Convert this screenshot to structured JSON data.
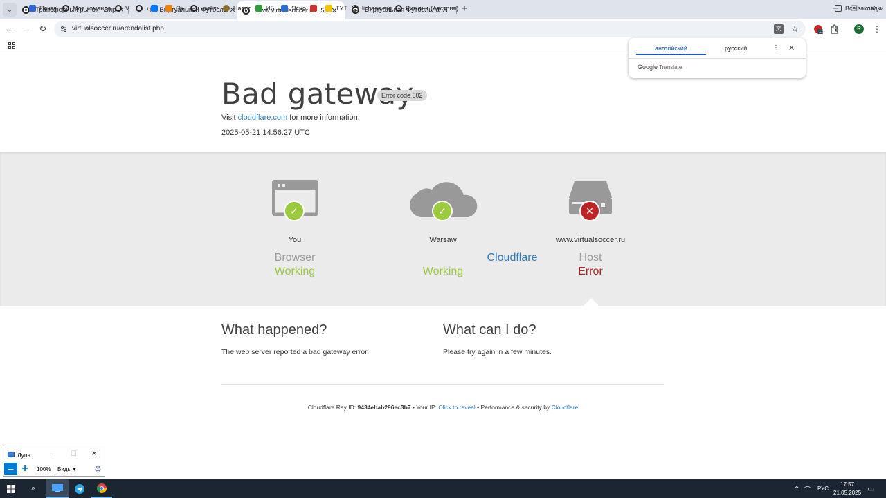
{
  "browser": {
    "tabs": [
      {
        "title": "Трансферный рынок - Виртуа",
        "close": "✕"
      },
      {
        "title": "Чат Виртуальной Футбольной",
        "close": "✕"
      },
      {
        "title": "www.virtualsoccer.ru | 502: Bad",
        "close": "✕"
      },
      {
        "title": "Виртуальная Футбольная Лига",
        "close": "✕"
      }
    ],
    "new_tab": "+",
    "address": "virtualsoccer.ru/arendalist.php",
    "profile_initial": "R",
    "ext_badge": "12",
    "bookmarks": [
      {
        "label": "Почта",
        "icon": "mail-icon",
        "color": "#3366cc"
      },
      {
        "label": "Моя команда",
        "icon": "soccer-ball-icon",
        "color": "#222222"
      },
      {
        "label": "V",
        "icon": "soccer-ball-icon",
        "color": "#222222"
      },
      {
        "label": "",
        "icon": "soccer-ball-icon",
        "color": "#222222"
      },
      {
        "label": "",
        "icon": "vk-icon",
        "color": "#0077ff"
      },
      {
        "label": "Ок",
        "icon": "ok-icon",
        "color": "#ee8208"
      },
      {
        "label": "vsolist",
        "icon": "soccer-ball-icon",
        "color": "#222222"
      },
      {
        "label": "Налог",
        "icon": "nalog-icon",
        "color": "#8b6d2a"
      },
      {
        "label": "ИБ",
        "icon": "ib-icon",
        "color": "#2e9d3a"
      },
      {
        "label": "Ясно",
        "icon": "yasno-icon",
        "color": "#2a6ecf"
      },
      {
        "label": "",
        "icon": "m-icon",
        "color": "#d32f2f"
      },
      {
        "label": "ТУТ",
        "icon": "tut-icon",
        "color": "#f5c400"
      },
      {
        "label": "lichess.org",
        "icon": "lichess-icon",
        "color": "#333333"
      },
      {
        "label": "Ритцинг (Австрия)",
        "icon": "soccer-ball-icon",
        "color": "#222222"
      }
    ],
    "all_bookmarks": "Все закладки"
  },
  "translate_popup": {
    "lang_from": "английский",
    "lang_to": "русский",
    "brand_google": "Google",
    "brand_translate": "Translate"
  },
  "page": {
    "title": "Bad gateway",
    "error_code": "Error code 502",
    "visit_prefix": "Visit",
    "visit_link": "cloudflare.com",
    "visit_suffix": "for more information.",
    "timestamp": "2025-05-21 14:56:27 UTC",
    "nodes": [
      {
        "label": "You",
        "role": "Browser",
        "status": "Working",
        "icon": "browser-icon",
        "state": "ok"
      },
      {
        "label": "Warsaw",
        "role": "Cloudflare",
        "status": "Working",
        "icon": "cloud-icon",
        "state": "ok"
      },
      {
        "label": "www.virtualsoccer.ru",
        "role": "Host",
        "status": "Error",
        "icon": "server-icon",
        "state": "error"
      }
    ],
    "what_happened_title": "What happened?",
    "what_happened_text": "The web server reported a bad gateway error.",
    "what_can_i_do_title": "What can I do?",
    "what_can_i_do_text": "Please try again in a few minutes.",
    "footer": {
      "ray_label": "Cloudflare Ray ID:",
      "ray_id": "9434ebab296ec3b7",
      "ip_label": "Your IP:",
      "ip_link": "Click to reveal",
      "perf_label": "Performance & security by",
      "perf_link": "Cloudflare"
    }
  },
  "magnifier": {
    "title": "Лупа",
    "zoom": "100%",
    "views": "Виды"
  },
  "taskbar": {
    "language": "РУС",
    "time": "17:57",
    "date": "21.05.2025"
  },
  "colors": {
    "ok": "#9bca3e",
    "error": "#bd2426",
    "link": "#2f7bbf"
  }
}
